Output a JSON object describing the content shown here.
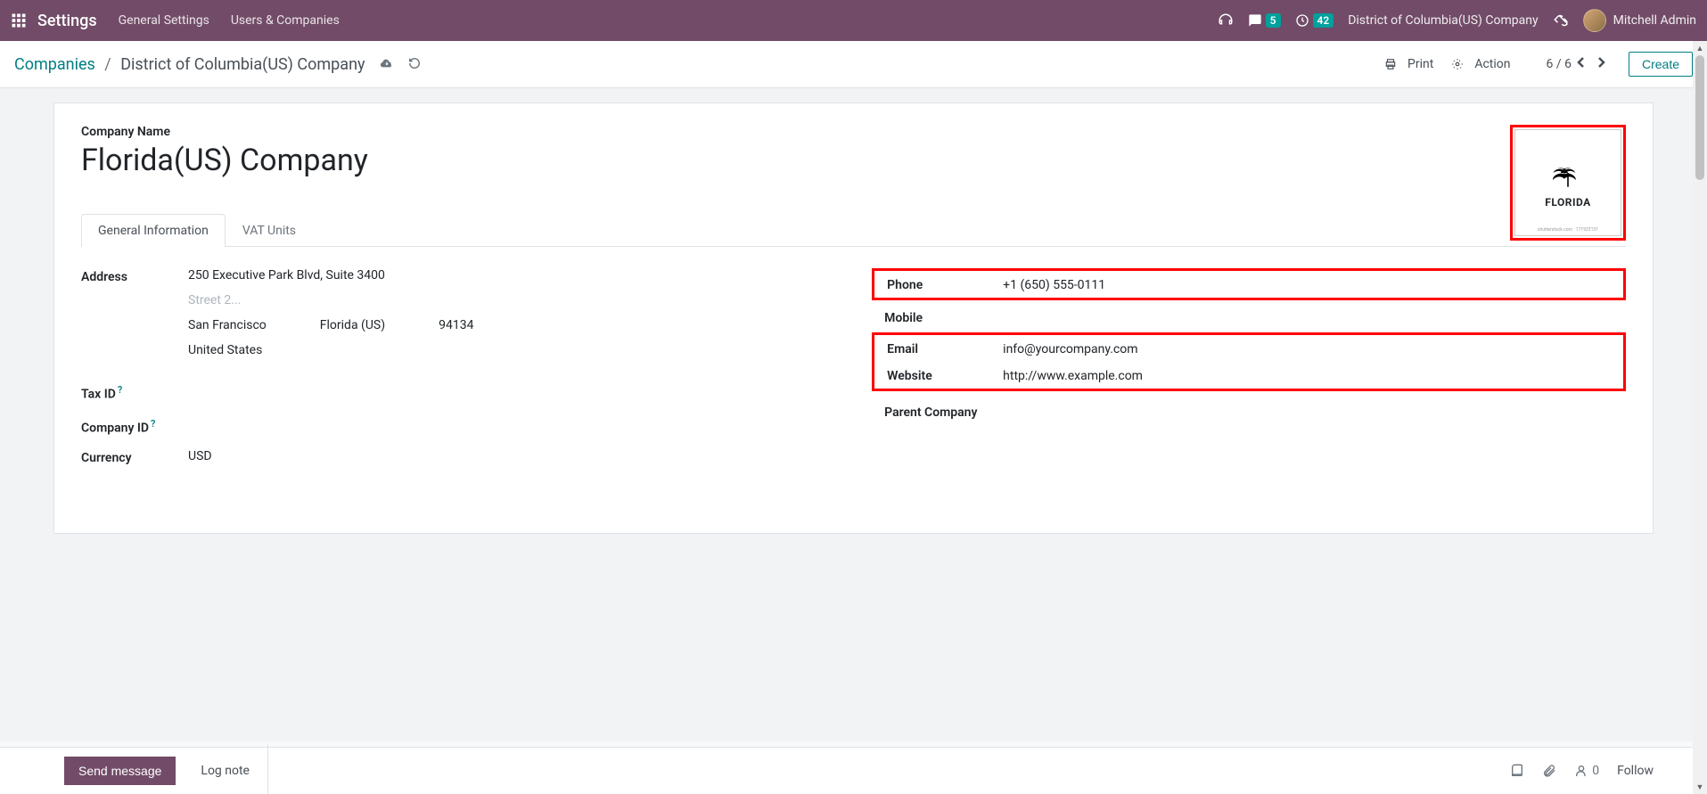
{
  "topbar": {
    "brand": "Settings",
    "nav": [
      "General Settings",
      "Users & Companies"
    ],
    "msg_badge": "5",
    "clock_badge": "42",
    "company_switch": "District of Columbia(US) Company",
    "user": "Mitchell Admin"
  },
  "breadcrumb": {
    "root": "Companies",
    "current": "District of Columbia(US) Company"
  },
  "controls": {
    "print": "Print",
    "action": "Action",
    "pager": "6 / 6",
    "create": "Create"
  },
  "form": {
    "name_label": "Company Name",
    "name_value": "Florida(US) Company",
    "logo_text": "FLORIDA",
    "logo_footer": "shutterstock.com · 171923131",
    "tabs": [
      "General Information",
      "VAT Units"
    ],
    "left": {
      "address_label": "Address",
      "street": "250 Executive Park Blvd, Suite 3400",
      "street2_placeholder": "Street 2...",
      "city": "San Francisco",
      "state": "Florida (US)",
      "zip": "94134",
      "country": "United States",
      "tax_id_label": "Tax ID",
      "company_id_label": "Company ID",
      "currency_label": "Currency",
      "currency_value": "USD"
    },
    "right": {
      "phone_label": "Phone",
      "phone_value": "+1 (650) 555-0111",
      "mobile_label": "Mobile",
      "email_label": "Email",
      "email_value": "info@yourcompany.com",
      "website_label": "Website",
      "website_value": "http://www.example.com",
      "parent_label": "Parent Company"
    }
  },
  "bottombar": {
    "send": "Send message",
    "log": "Log note",
    "follow_count": "0",
    "follow": "Follow"
  }
}
